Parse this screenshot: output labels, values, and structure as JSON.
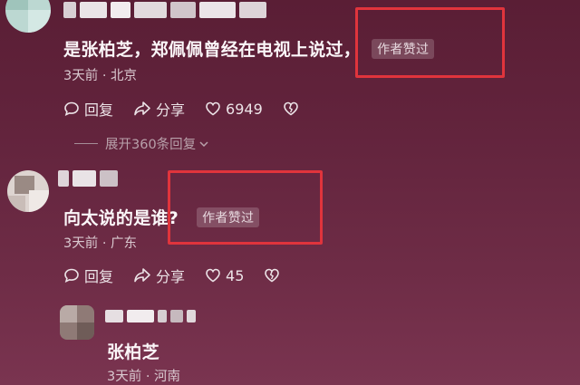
{
  "comments": [
    {
      "text": "是张柏芝，郑佩佩曾经在电视上说过，",
      "badge": "作者赞过",
      "meta": "3天前 · 北京",
      "reply_label": "回复",
      "share_label": "分享",
      "like_count": "6949",
      "expand_label": "展开360条回复"
    },
    {
      "text": "向太说的是谁?",
      "badge": "作者赞过",
      "meta": "3天前 · 广东",
      "reply_label": "回复",
      "share_label": "分享",
      "like_count": "45"
    },
    {
      "text": "张柏芝",
      "meta": "3天前 · 河南"
    }
  ],
  "colors": {
    "highlight_box": "#e0343c",
    "background": "#63243d"
  }
}
